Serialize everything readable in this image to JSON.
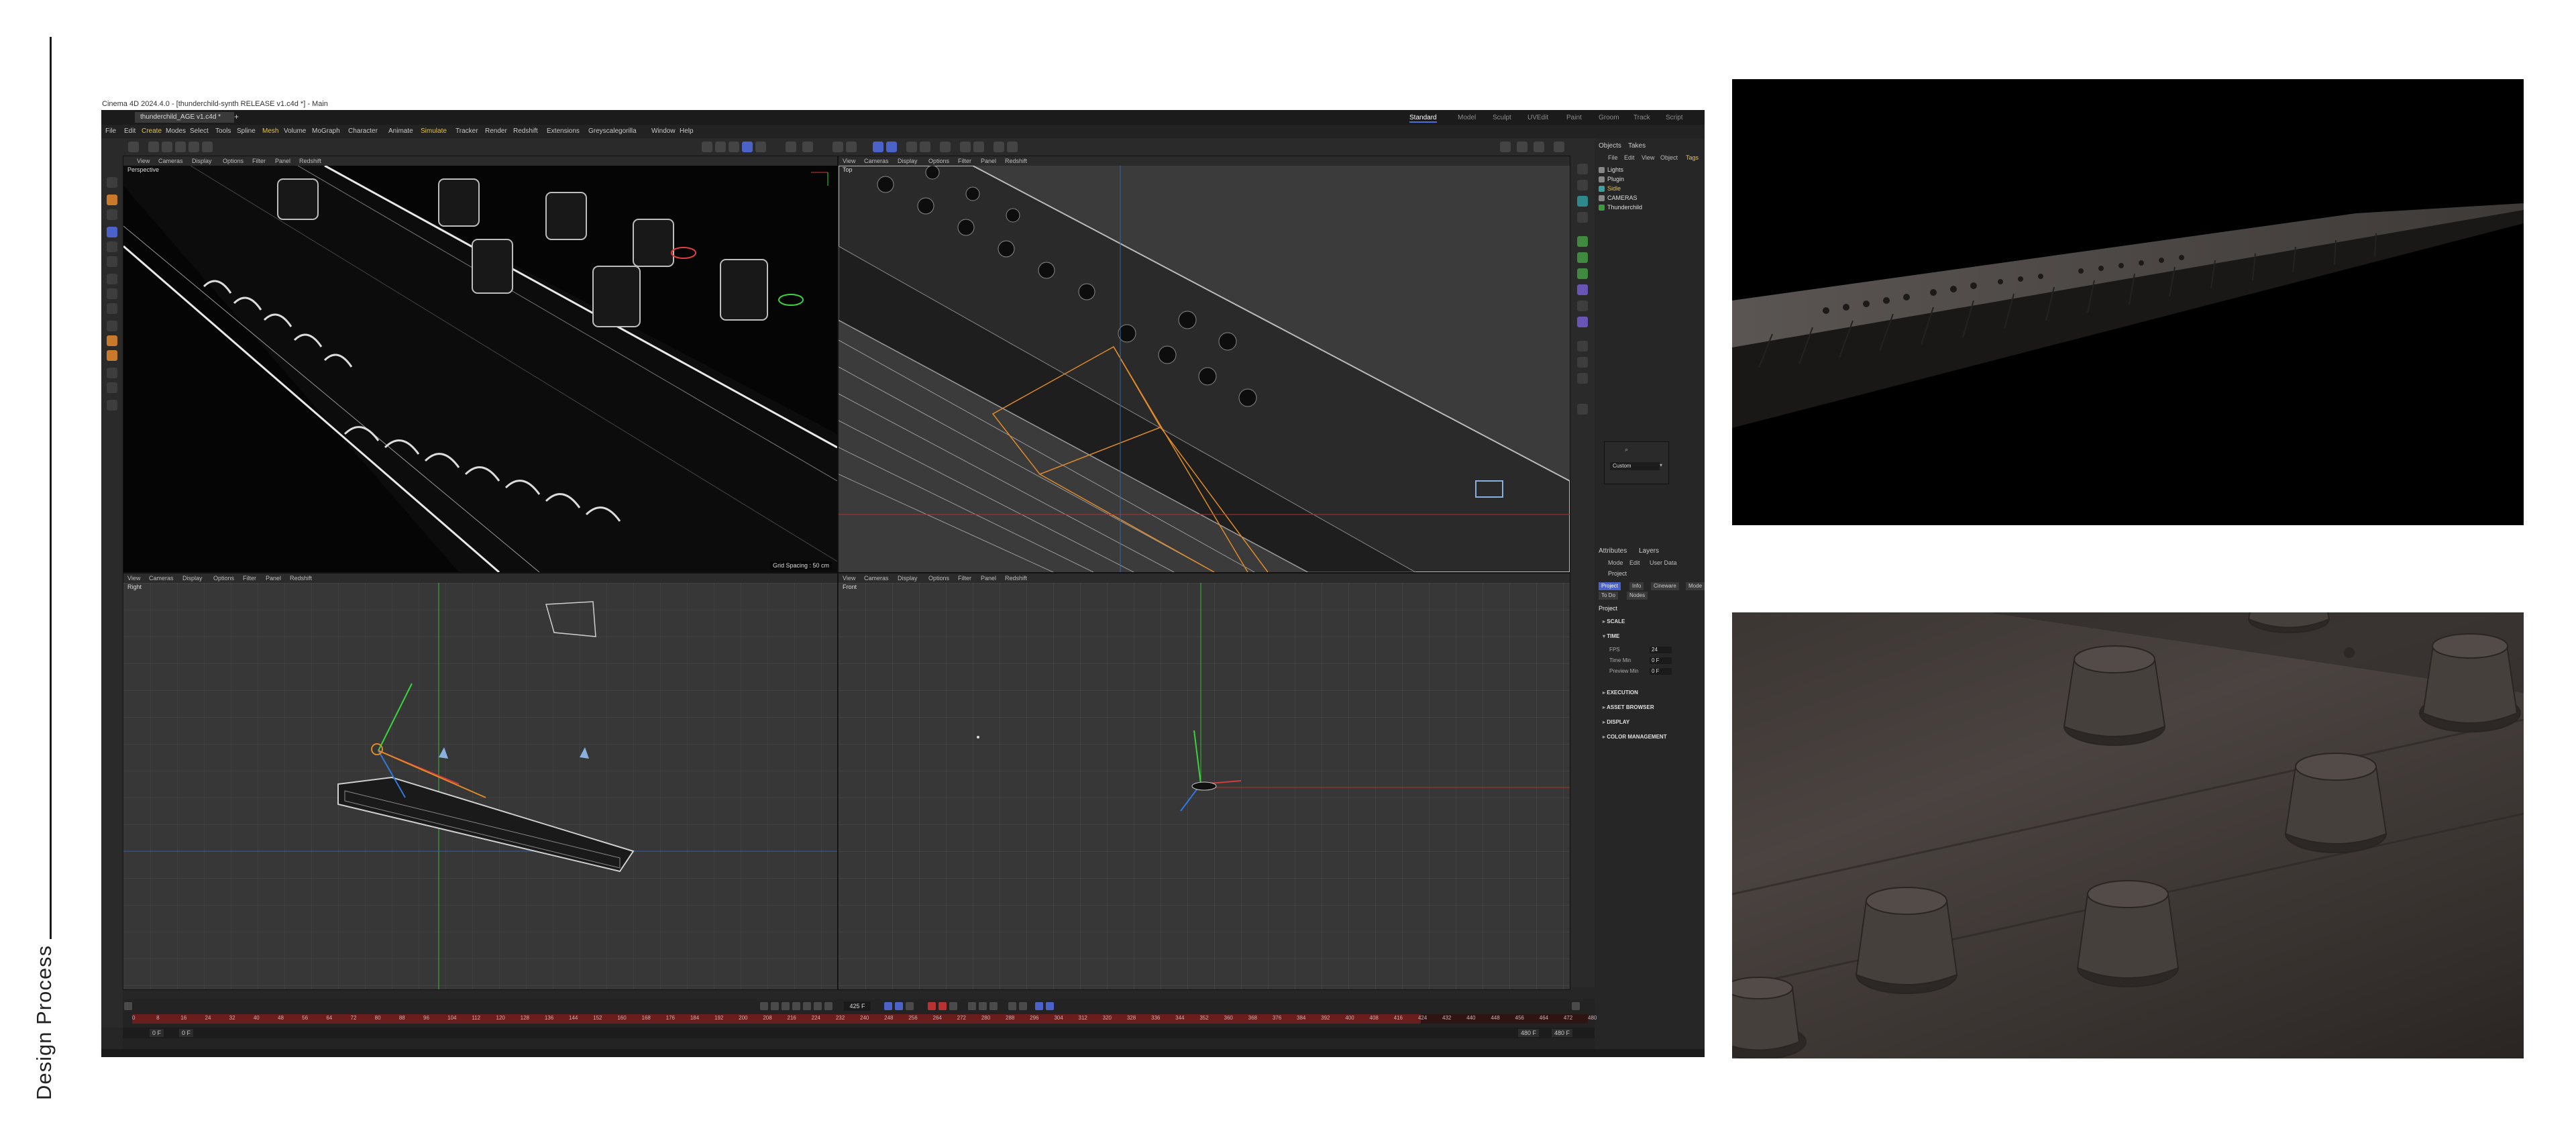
{
  "page": {
    "side_label": "Design Process"
  },
  "app": {
    "window_title": "Cinema 4D 2024.4.0 - [thunderchild-synth RELEASE v1.c4d *] - Main",
    "document_tab": "thunderchild_AGE v1.c4d *",
    "menu": [
      "File",
      "Edit",
      "Create",
      "Modes",
      "Select",
      "Tools",
      "Spline",
      "Mesh",
      "Volume",
      "MoGraph",
      "Character",
      "Animate",
      "Simulate",
      "Tracker",
      "Render",
      "Redshift",
      "Extensions",
      "Greyscalegorilla",
      "Window",
      "Help"
    ],
    "layouts": [
      "Standard",
      "Model",
      "Sculpt",
      "UVEdit",
      "Paint",
      "Groom",
      "Track",
      "Script"
    ],
    "active_layout": "Standard"
  },
  "viewports": [
    {
      "label": "Perspective",
      "menu": [
        "View",
        "Cameras",
        "Display",
        "Options",
        "Filter",
        "Panel",
        "Redshift"
      ],
      "grid_spacing": "Grid Spacing : 50 cm"
    },
    {
      "label": "Top",
      "menu": [
        "View",
        "Cameras",
        "Display",
        "Options",
        "Filter",
        "Panel",
        "Redshift"
      ]
    },
    {
      "label": "Right",
      "menu": [
        "View",
        "Cameras",
        "Display",
        "Options",
        "Filter",
        "Panel",
        "Redshift"
      ]
    },
    {
      "label": "Front",
      "menu": [
        "View",
        "Cameras",
        "Display",
        "Options",
        "Filter",
        "Panel",
        "Redshift"
      ]
    }
  ],
  "objects_panel": {
    "tabs": [
      "Objects",
      "Takes"
    ],
    "menu": [
      "File",
      "Edit",
      "View",
      "Object",
      "Tags"
    ],
    "items": [
      "Lights",
      "Plugin",
      "Sidle",
      "CAMERAS",
      "Thunderchild"
    ]
  },
  "attributes_panel": {
    "tabs": [
      "Attributes",
      "Layers"
    ],
    "menu": [
      "Mode",
      "Edit",
      "User Data"
    ],
    "object": "Project",
    "preset": "Custom",
    "sub_tabs": [
      "Project",
      "Info",
      "Cineware",
      "Mode",
      "To Do",
      "Nodes"
    ],
    "heading": "Project",
    "sections": [
      "SCALE",
      "TIME",
      "EXECUTION",
      "ASSET BROWSER",
      "DISPLAY",
      "COLOR MANAGEMENT"
    ],
    "time_fields": [
      {
        "label": "FPS",
        "value": "24"
      },
      {
        "label": "Time Min",
        "value": "0 F"
      },
      {
        "label": "Preview Min",
        "value": "0 F"
      }
    ]
  },
  "timeline": {
    "current_frame": "425 F",
    "ticks": [
      "0",
      "8",
      "16",
      "24",
      "32",
      "40",
      "48",
      "56",
      "64",
      "72",
      "80",
      "88",
      "96",
      "104",
      "112",
      "120",
      "128",
      "136",
      "144",
      "152",
      "160",
      "168",
      "176",
      "184",
      "192",
      "200",
      "208",
      "216",
      "224",
      "232",
      "240",
      "248",
      "256",
      "264",
      "272",
      "280",
      "288",
      "296",
      "304",
      "312",
      "320",
      "328",
      "336",
      "344",
      "352",
      "360",
      "368",
      "376",
      "384",
      "392",
      "400",
      "408",
      "416",
      "424",
      "432",
      "440",
      "448",
      "456",
      "464",
      "472",
      "480"
    ],
    "range_start": "0 F",
    "range_start_2": "0 F",
    "range_end": "480 F",
    "range_end_2": "480 F"
  },
  "colors": {
    "accent": "#4b63c8",
    "menu_highlight": "#e6c34a",
    "timeline_red": "#6a1d1d",
    "selection_orange": "#d2691e"
  }
}
